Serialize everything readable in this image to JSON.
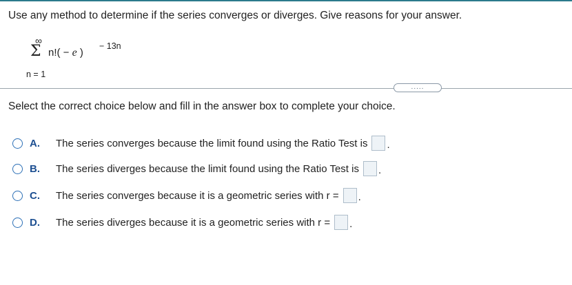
{
  "question": {
    "text": "Use any method to determine if the series converges or diverges. Give reasons for your answer."
  },
  "series": {
    "upper_limit": "∞",
    "sigma": "Σ",
    "term_prefix": "n!( −",
    "term_variable": "e",
    "term_suffix": ")",
    "exponent": "− 13n",
    "lower_limit": "n = 1"
  },
  "divider": {
    "button_label": "....."
  },
  "instruction": {
    "text": "Select the correct choice below and fill in the answer box to complete your choice."
  },
  "choices": [
    {
      "letter": "A.",
      "text": "The series converges because the limit found using the Ratio Test is",
      "period": "."
    },
    {
      "letter": "B.",
      "text": "The series diverges because the limit found using the Ratio Test is",
      "period": "."
    },
    {
      "letter": "C.",
      "text": "The series converges because it is a geometric series with r =",
      "period": "."
    },
    {
      "letter": "D.",
      "text": "The series diverges because it is a geometric series with r =",
      "period": "."
    }
  ],
  "colors": {
    "accent": "#1d4f91",
    "radio_border": "#2b6fb6",
    "answer_box_fill": "#eef3f7",
    "top_rule": "#2b7a8c"
  }
}
